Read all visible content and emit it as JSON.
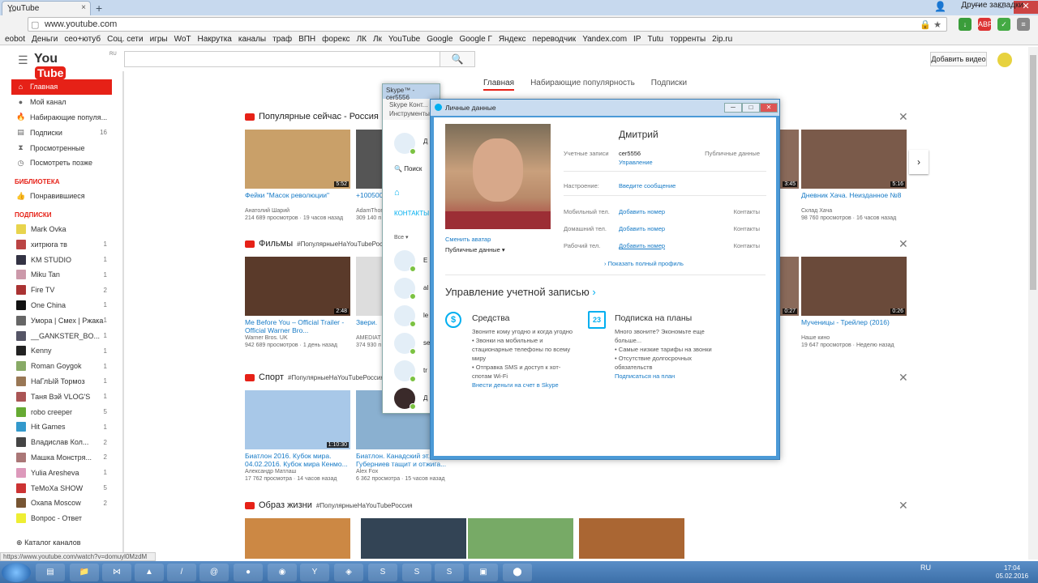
{
  "browser": {
    "tab_title": "YouTube",
    "url": "www.youtube.com",
    "bookmarks": [
      "еobot",
      "Деньги",
      "сео+ютуб",
      "Соц. сети",
      "игры",
      "WoT",
      "Накрутка",
      "каналы",
      "траф",
      "ВПН",
      "форекс",
      "ЛК",
      "Лк",
      "YouTube",
      "Google",
      "Google Г",
      "Яндекс",
      "переводчик",
      "Yandex.com",
      "IP",
      "Tutu",
      "торренты",
      "2ip.ru"
    ],
    "other_bookmarks": "Другие закладки",
    "status_url": "https://www.youtube.com/watch?v=domuyl0MzdM",
    "icon_colors": {
      "accent": "#e62117",
      "link": "#167ac6",
      "skype": "#00aff0"
    }
  },
  "youtube": {
    "logo_you": "You",
    "logo_tube": "Tube",
    "logo_region": "RU",
    "upload_label": "Добавить видео",
    "tabs": [
      "Главная",
      "Набирающие популярность",
      "Подписки"
    ],
    "sidebar": {
      "main": [
        {
          "label": "Главная",
          "count": ""
        },
        {
          "label": "Мой канал",
          "count": ""
        },
        {
          "label": "Набирающие популя...",
          "count": ""
        },
        {
          "label": "Подписки",
          "count": "16"
        },
        {
          "label": "Просмотренные",
          "count": ""
        },
        {
          "label": "Посмотреть позже",
          "count": ""
        }
      ],
      "library_head": "БИБЛИОТЕКА",
      "library": [
        {
          "label": "Понравившиеся",
          "count": ""
        }
      ],
      "subs_head": "ПОДПИСКИ",
      "subs": [
        {
          "label": "Mark Ovka",
          "count": ""
        },
        {
          "label": "хитрюга тв",
          "count": "1"
        },
        {
          "label": "KM STUDIO",
          "count": "1"
        },
        {
          "label": "Miku Tan",
          "count": "1"
        },
        {
          "label": "Fire TV",
          "count": "2"
        },
        {
          "label": "One China",
          "count": "1"
        },
        {
          "label": "Умора | Смех | Ржака",
          "count": "1"
        },
        {
          "label": "__GANKSTER_BO...",
          "count": "1"
        },
        {
          "label": "Kenny",
          "count": "1"
        },
        {
          "label": "Roman Goygok",
          "count": "1"
        },
        {
          "label": "НаГлЫй Тормоз",
          "count": "1"
        },
        {
          "label": "Таня Вэй VLOG'S",
          "count": "1"
        },
        {
          "label": "robo creeper",
          "count": "5"
        },
        {
          "label": "Hit Games",
          "count": "1"
        },
        {
          "label": "Владислав Кол...",
          "count": "2"
        },
        {
          "label": "Машка Монстря...",
          "count": "2"
        },
        {
          "label": "Yulia Aresheva",
          "count": "1"
        },
        {
          "label": "ТеМоХа SHOW",
          "count": "5"
        },
        {
          "label": "Охапа Moscow",
          "count": "2"
        },
        {
          "label": "Вопрос - Ответ",
          "count": ""
        }
      ],
      "catalog": "Каталог каналов"
    },
    "shelves": [
      {
        "title": "Популярные сейчас - Россия",
        "tag": "#ПопулярныеНаYouTubeРоссия",
        "videos": [
          {
            "title": "Фейки \"Масок революции\"",
            "channel": "Анатолий Шарий",
            "views": "214 689 просмотров",
            "age": "19 часов назад",
            "duration": "5:52"
          },
          {
            "title": "+100500 - Exclusive",
            "channel": "AdamThomas",
            "views": "309 140 п",
            "age": "",
            "duration": ""
          },
          {
            "title": "Дневник Хача. Неизданное №8",
            "channel": "Склад Хача",
            "views": "98 760 просмотров",
            "age": "16 часов назад",
            "duration": "5:16"
          }
        ]
      },
      {
        "title": "Фильмы",
        "tag": "#ПопулярныеНаYouTubeРоссия",
        "videos": [
          {
            "title": "Me Before You – Official Trailer - Official Warner Bro...",
            "channel": "Warner Bros. UK",
            "views": "942 689 просмотров",
            "age": "1 день назад",
            "duration": "2:48"
          },
          {
            "title": "Звери.",
            "channel": "AMEDIAT",
            "views": "374 930 п",
            "age": "",
            "duration": ""
          },
          {
            "title": "Мученицы - Трейлер (2016)",
            "channel": "Наше кино",
            "views": "19 647 просмотров",
            "age": "Неделю назад",
            "duration": "0:26"
          }
        ]
      },
      {
        "title": "Спорт",
        "tag": "#ПопулярныеНаYouTubeРоссия",
        "videos": [
          {
            "title": "Биатлон 2016. Кубок мира. 04.02.2016. Кубок мира Кенмо...",
            "channel": "Александр Матлаш",
            "views": "17 762 просмотра",
            "age": "14 часов назад",
            "duration": "1:10:30"
          },
          {
            "title": "Биатлон. Канадский эт... Губерниев тащит и отжига...",
            "channel": "Alex Fox",
            "views": "6 362 просмотра",
            "age": "15 часов назад",
            "duration": ""
          }
        ]
      },
      {
        "title": "Образ жизни",
        "tag": "#ПопулярныеНаYouTubeРоссия",
        "videos": []
      }
    ],
    "extra_durations": [
      "3:45",
      "0:27"
    ]
  },
  "skype": {
    "title": "Skype™ - cer5556",
    "menu": [
      "Skype",
      "Конт...",
      "Инструменты"
    ],
    "search_label": "Поиск",
    "contacts_label": "КОНТАКТЫ",
    "filter_label": "Все",
    "contact_initials": [
      "Д",
      "E",
      "al",
      "le",
      "se",
      "tr",
      "Д"
    ]
  },
  "profile": {
    "window_title": "Личные данные",
    "name": "Дмитрий",
    "change_avatar": "Сменить аватар",
    "public_data": "Публичные данные",
    "rows": [
      {
        "label": "Учетные записи",
        "value": "cer5556",
        "value2": "Управление",
        "right": "Публичные данные"
      },
      {
        "label": "Настроение:",
        "value": "Введите сообщение",
        "right": ""
      },
      {
        "label": "Мобильный тел.",
        "value": "Добавить номер",
        "right": "Контакты"
      },
      {
        "label": "Домашний тел.",
        "value": "Добавить номер",
        "right": "Контакты"
      },
      {
        "label": "Рабочий тел.",
        "value": "Добавить номер",
        "right": "Контакты"
      }
    ],
    "show_full": "Показать полный профиль",
    "account_heading": "Управление учетной записью",
    "funds": {
      "title": "Средства",
      "lines": [
        "Звоните кому угодно и когда угодно",
        "• Звонки на мобильные и стационарные телефоны по всему миру",
        "• Отправка SMS и доступ к хот-спотам Wi-Fi"
      ],
      "link": "Внести деньги на счет в Skype"
    },
    "plan": {
      "title": "Подписка на планы",
      "lines": [
        "Много звоните? Экономьте еще больше...",
        "• Самые низкие тарифы на звонки",
        "• Отсутствие долгосрочных обязательств"
      ],
      "link": "Подписаться на план",
      "icon_number": "23"
    }
  },
  "taskbar": {
    "lang": "RU",
    "time": "17:04",
    "date": "05.02.2016"
  }
}
